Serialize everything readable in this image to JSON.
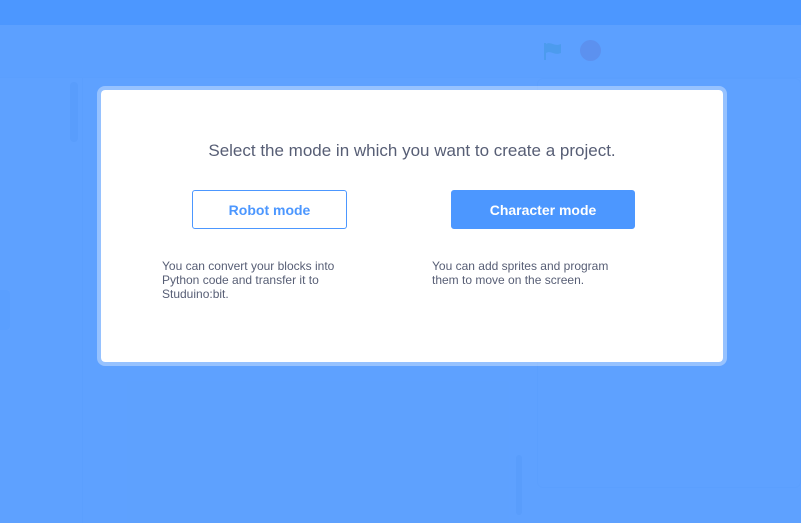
{
  "modal": {
    "title": "Select the mode in which you want to create a project.",
    "robot_button_label": "Robot mode",
    "character_button_label": "Character mode",
    "robot_description": "You can convert your blocks into\nPython code and transfer it to\nStuduino:bit.",
    "character_description": "You can add sprites and program\nthem to move on the screen."
  },
  "background": {
    "icons": [
      "green-flag-icon",
      "stop-icon"
    ]
  },
  "colors": {
    "accent": "#4c97ff",
    "text": "#575e75",
    "overlay": "#5b9bff",
    "stop": "#ec5959",
    "flag": "#4cbf56"
  }
}
